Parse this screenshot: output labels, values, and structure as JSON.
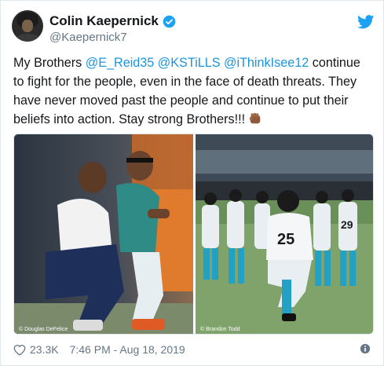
{
  "author": {
    "name": "Colin Kaepernick",
    "handle": "@Kaepernick7"
  },
  "tweet": {
    "segments": [
      {
        "text": "My Brothers ",
        "type": "text"
      },
      {
        "text": "@E_Reid35",
        "type": "mention"
      },
      {
        "text": " ",
        "type": "text"
      },
      {
        "text": "@KSTiLLS",
        "type": "mention"
      },
      {
        "text": " ",
        "type": "text"
      },
      {
        "text": "@iThinkIsee12",
        "type": "mention"
      },
      {
        "text": " continue to fight for the people, even in the face of death threats. They have never moved past the people and continue to put their beliefs into action. Stay strong Brothers!!!",
        "type": "text"
      }
    ],
    "emoji": "raised-fist-emoji"
  },
  "media": {
    "left_credit": "© Douglas DeFelice",
    "right_credit": "© Brandon Todd"
  },
  "footer": {
    "likes": "23.3K",
    "timestamp": "7:46 PM - Aug 18, 2019"
  },
  "colors": {
    "link": "#1b95e0",
    "muted": "#657786",
    "verified": "#1da1f2"
  }
}
